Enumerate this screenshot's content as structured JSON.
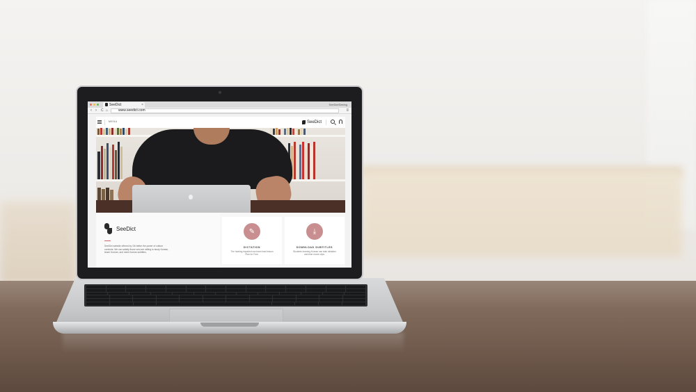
{
  "browser": {
    "tab_title": "SeeDict",
    "tab_close": "×",
    "user_label": "SeeDictSeeing",
    "url": "www.seedict.com",
    "nav": {
      "back": "‹",
      "forward": "›",
      "reload": "C",
      "menu": "≡"
    }
  },
  "site": {
    "header": {
      "menu_label": "MENU",
      "brand": "SeeDict"
    },
    "about": {
      "brand": "SeeDict",
      "text": "SeeDict website offered by Citi better the power of culture contents. We can satisfy those who are willing to study Korean, teach Korean, and need Korean subtitles."
    },
    "cards": [
      {
        "icon": "✎",
        "title": "DICTATION",
        "text": "The hearing impaired can learn lead lesson Plan for Free."
      },
      {
        "icon": "⤓",
        "title": "DOWNLOAD SUBTITLES",
        "text": "Students learning Korean can take dictation and time movie clips."
      }
    ]
  },
  "colors": {
    "accent": "#c98f90",
    "red_rule": "#c76a6a",
    "dot_red": "#ed6a5e",
    "dot_yellow": "#f5bf4f",
    "dot_green": "#61c454"
  }
}
